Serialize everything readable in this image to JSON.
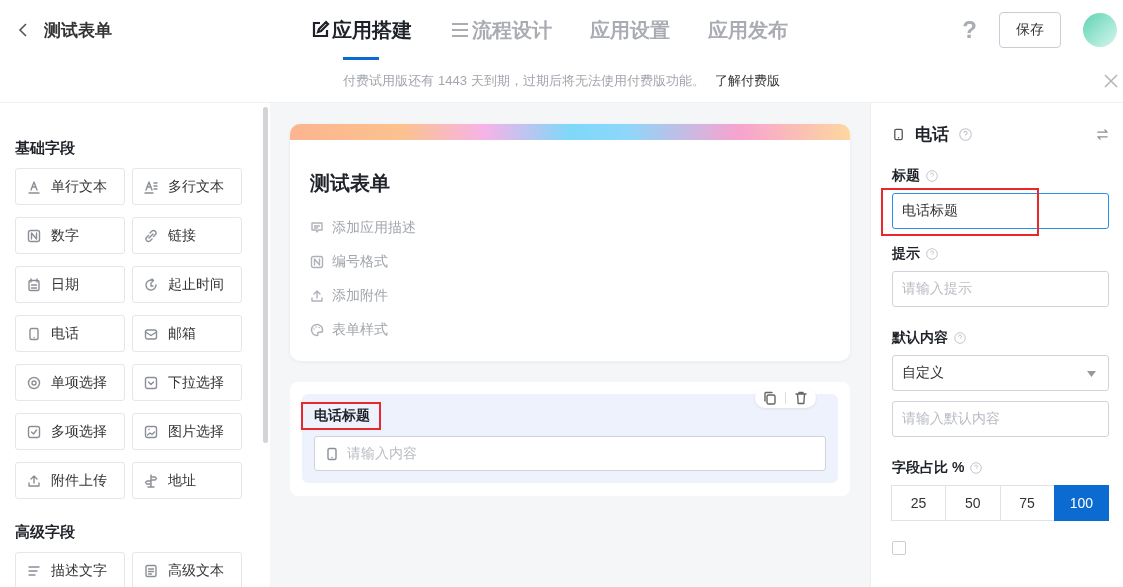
{
  "header": {
    "back_title": "测试表单",
    "tabs": [
      {
        "label": "应用搭建",
        "kind": "edit",
        "selected": true
      },
      {
        "label": "流程设计",
        "kind": "flow",
        "selected": false
      },
      {
        "label": "应用设置",
        "kind": "none",
        "selected": false
      },
      {
        "label": "应用发布",
        "kind": "none",
        "selected": false
      }
    ],
    "help": "?",
    "save": "保存"
  },
  "notice": {
    "text": "付费试用版还有 1443 天到期，过期后将无法使用付费版功能。",
    "link": "了解付费版"
  },
  "palette": [
    {
      "title": "基础字段",
      "items": [
        {
          "label": "单行文本",
          "kind": "text"
        },
        {
          "label": "多行文本",
          "kind": "textarea"
        },
        {
          "label": "数字",
          "kind": "number"
        },
        {
          "label": "链接",
          "kind": "link"
        },
        {
          "label": "日期",
          "kind": "date"
        },
        {
          "label": "起止时间",
          "kind": "range"
        },
        {
          "label": "电话",
          "kind": "phone"
        },
        {
          "label": "邮箱",
          "kind": "mail"
        },
        {
          "label": "单项选择",
          "kind": "radio"
        },
        {
          "label": "下拉选择",
          "kind": "select"
        },
        {
          "label": "多项选择",
          "kind": "check"
        },
        {
          "label": "图片选择",
          "kind": "image"
        },
        {
          "label": "附件上传",
          "kind": "upload"
        },
        {
          "label": "地址",
          "kind": "address"
        }
      ]
    },
    {
      "title": "高级字段",
      "items": [
        {
          "label": "描述文字",
          "kind": "desc"
        },
        {
          "label": "高级文本",
          "kind": "doc"
        }
      ]
    }
  ],
  "form": {
    "title": "测试表单",
    "actions": [
      {
        "label": "添加应用描述",
        "kind": "comment"
      },
      {
        "label": "编号格式",
        "kind": "number"
      },
      {
        "label": "添加附件",
        "kind": "upload"
      },
      {
        "label": "表单样式",
        "kind": "palette"
      }
    ],
    "field": {
      "label": "电话标题",
      "highlighted": true,
      "placeholder": "请输入内容"
    }
  },
  "properties": {
    "title": "电话",
    "title_label": "标题",
    "title_value": "电话标题",
    "title_highlighted": true,
    "hint_label": "提示",
    "hint_placeholder": "请输入提示",
    "default_label": "默认内容",
    "default_value": "自定义",
    "default_placeholder": "请输入默认内容",
    "width_label": "字段占比 %",
    "widths": [
      {
        "label": "25",
        "selected": false
      },
      {
        "label": "50",
        "selected": false
      },
      {
        "label": "75",
        "selected": false
      },
      {
        "label": "100",
        "selected": true
      }
    ],
    "checkbox": {
      "checked": false
    }
  }
}
